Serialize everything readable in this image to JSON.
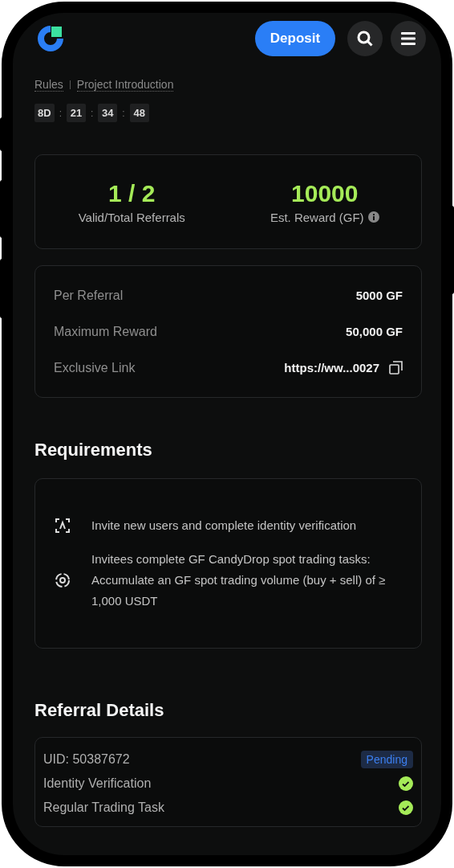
{
  "header": {
    "deposit_button": "Deposit"
  },
  "links": [
    "Rules",
    "Project Introduction"
  ],
  "countdown": [
    {
      "kind": "unit",
      "text": "8D"
    },
    {
      "kind": "separator",
      "text": ":"
    },
    {
      "kind": "unit",
      "text": "21"
    },
    {
      "kind": "separator",
      "text": ":"
    },
    {
      "kind": "unit",
      "text": "34"
    },
    {
      "kind": "separator",
      "text": ":"
    },
    {
      "kind": "unit",
      "text": "48"
    }
  ],
  "stats": [
    {
      "value": "1 / 2",
      "label": "Valid/Total Referrals",
      "info": false
    },
    {
      "value": "10000",
      "label": "Est. Reward (GF)",
      "info": true
    }
  ],
  "details": [
    {
      "label": "Per Referral",
      "value": "5000 GF",
      "copyable": false
    },
    {
      "label": "Maximum Reward",
      "value": "50,000 GF",
      "copyable": false
    },
    {
      "label": "Exclusive Link",
      "value": "https://ww...0027",
      "copyable": true
    }
  ],
  "requirements": {
    "title": "Requirements",
    "items": [
      {
        "kind": "identity",
        "text": "Invite new users and complete identity verification"
      },
      {
        "kind": "trade",
        "text": "Invitees complete GF CandyDrop spot trading tasks: Accumulate an GF spot trading volume (buy + sell) of ≥ 1,000 USDT"
      }
    ]
  },
  "referral_details": {
    "title": "Referral Details",
    "uid": "UID: 50387672",
    "status": "Pending",
    "tasks": [
      {
        "label": "Identity Verification",
        "done": true
      },
      {
        "label": "Regular Trading Task",
        "done": true
      }
    ]
  }
}
